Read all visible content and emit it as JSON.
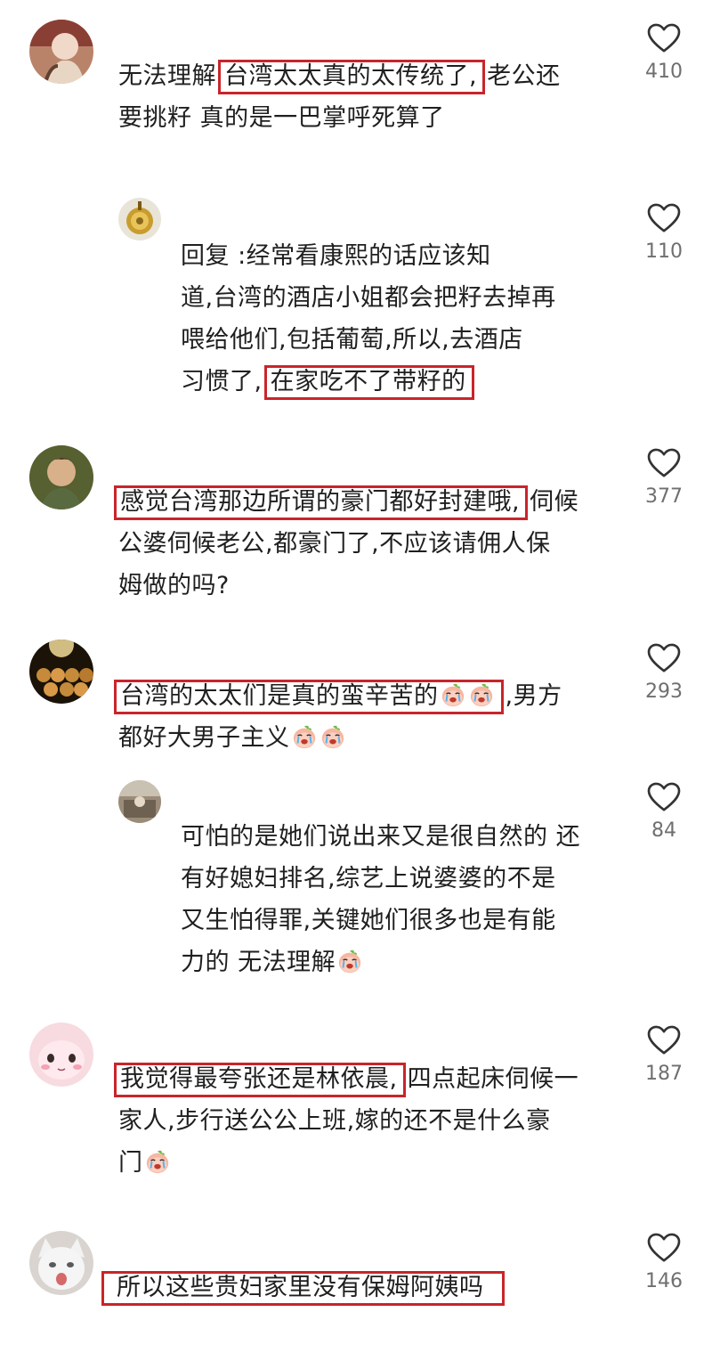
{
  "comments": [
    {
      "id": "c1",
      "likes": "410",
      "lines": [
        {
          "pre": "无法理解",
          "hl": "台湾太太真的太传统了,",
          "post": "老公还"
        },
        {
          "pre": "要挑籽  真的是一巴掌呼死算了",
          "hl": "",
          "post": ""
        }
      ]
    },
    {
      "id": "r1",
      "likes": "110",
      "lines": [
        {
          "pre": "回复        :经常看康熙的话应该知",
          "hl": "",
          "post": ""
        },
        {
          "pre": "道,台湾的酒店小姐都会把籽去掉再",
          "hl": "",
          "post": ""
        },
        {
          "pre": "喂给他们,包括葡萄,所以,去酒店",
          "hl": "",
          "post": ""
        },
        {
          "pre": "习惯了,",
          "hl": "在家吃不了带籽的",
          "post": ""
        }
      ]
    },
    {
      "id": "c2",
      "likes": "377",
      "lines": [
        {
          "pre": "",
          "hl": "感觉台湾那边所谓的豪门都好封建哦,",
          "post": "伺候"
        },
        {
          "pre": "公婆伺候老公,都豪门了,不应该请佣人保",
          "hl": "",
          "post": ""
        },
        {
          "pre": "姆做的吗?",
          "hl": "",
          "post": ""
        }
      ]
    },
    {
      "id": "c3",
      "likes": "293",
      "line1_pre": "",
      "line1_hl": "台湾的太太们是真的蛮辛苦的",
      "line1_post": ",男方",
      "line2": "都好大男子主义"
    },
    {
      "id": "r2",
      "likes": "84",
      "lines": [
        {
          "pre": "可怕的是她们说出来又是很自然的 还",
          "hl": "",
          "post": ""
        },
        {
          "pre": "有好媳妇排名,综艺上说婆婆的不是",
          "hl": "",
          "post": ""
        },
        {
          "pre": "又生怕得罪,关键她们很多也是有能",
          "hl": "",
          "post": ""
        }
      ],
      "last_line": "力的 无法理解"
    },
    {
      "id": "c4",
      "likes": "187",
      "lines": [
        {
          "pre": "",
          "hl": "我觉得最夸张还是林依晨,",
          "post": "四点起床伺候一"
        },
        {
          "pre": "家人,步行送公公上班,嫁的还不是什么豪",
          "hl": "",
          "post": ""
        }
      ],
      "last_line": "门"
    },
    {
      "id": "c5",
      "likes": "146",
      "lines": [
        {
          "pre": "",
          "hl": "所以这些贵妇家里没有保姆阿姨吗",
          "post": ""
        }
      ]
    }
  ],
  "icons": {
    "like": "heart-outline-icon",
    "emoji": "crying-peach-emoji"
  },
  "colors": {
    "highlight_border": "#c8252b",
    "count": "#6f6f6f",
    "text": "#1f1f1f"
  }
}
